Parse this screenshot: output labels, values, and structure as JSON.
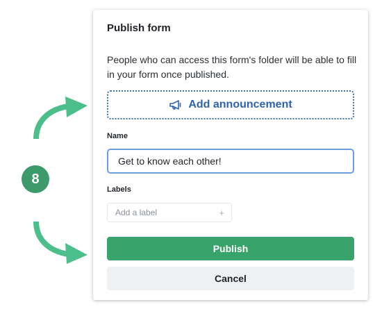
{
  "dialog": {
    "title": "Publish form",
    "description": "People who can access this form's folder will be able to fill in your form once published.",
    "announcement_button": {
      "label": "Add announcement",
      "icon": "megaphone-icon"
    },
    "name_field": {
      "label": "Name",
      "value": "Get to know each other!"
    },
    "labels_field": {
      "label": "Labels",
      "placeholder": "Add a label",
      "icon": "plus-icon"
    },
    "publish_button": "Publish",
    "cancel_button": "Cancel"
  },
  "annotation": {
    "step_number": "8"
  },
  "colors": {
    "accent_green": "#38a46b",
    "link_blue": "#2f63b0",
    "arrow_green": "#4cbe8c",
    "badge_green": "#3d9b6b"
  }
}
